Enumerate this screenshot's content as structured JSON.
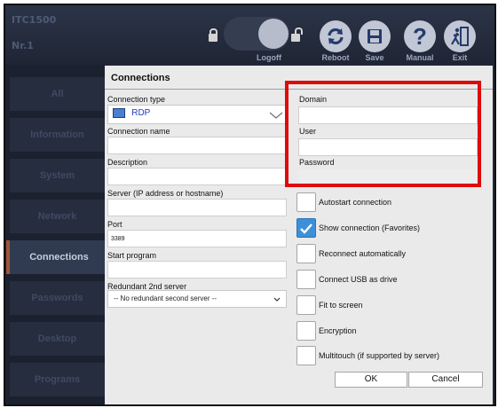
{
  "header": {
    "device_name": "ITC1500",
    "device_nr": "Nr.1",
    "toolbar": {
      "logoff": "Logoff",
      "reboot": "Reboot",
      "save": "Save",
      "manual": "Manual",
      "exit": "Exit"
    }
  },
  "sidebar": {
    "items": [
      {
        "label": "All"
      },
      {
        "label": "Information"
      },
      {
        "label": "System"
      },
      {
        "label": "Network"
      },
      {
        "label": "Connections"
      },
      {
        "label": "Passwords"
      },
      {
        "label": "Desktop"
      },
      {
        "label": "Programs"
      }
    ],
    "active": "Connections"
  },
  "panel": {
    "title": "Connections",
    "connection_type_label": "Connection type",
    "connection_type_value": "RDP",
    "connection_name_label": "Connection name",
    "connection_name_value": "",
    "description_label": "Description",
    "description_value": "",
    "server_label": "Server (IP address or hostname)",
    "server_value": "",
    "port_label": "Port",
    "port_value": "3389",
    "start_program_label": "Start program",
    "start_program_value": "",
    "redundant_label": "Redundant 2nd server",
    "redundant_value": "-- No redundant second server --",
    "domain_label": "Domain",
    "domain_value": "",
    "user_label": "User",
    "user_value": "",
    "password_label": "Password",
    "password_value": "",
    "options": [
      {
        "label": "Autostart connection",
        "checked": false
      },
      {
        "label": "Show connection (Favorites)",
        "checked": true
      },
      {
        "label": "Reconnect automatically",
        "checked": false
      },
      {
        "label": "Connect USB as drive",
        "checked": false
      },
      {
        "label": "Fit to screen",
        "checked": false
      },
      {
        "label": "Encryption",
        "checked": false
      },
      {
        "label": "Multitouch (if supported by server)",
        "checked": false
      }
    ],
    "ok_label": "OK",
    "cancel_label": "Cancel"
  },
  "colors": {
    "highlight": "#de0b0b",
    "checked": "#3d8fd8",
    "active_accent": "#a0563a"
  }
}
